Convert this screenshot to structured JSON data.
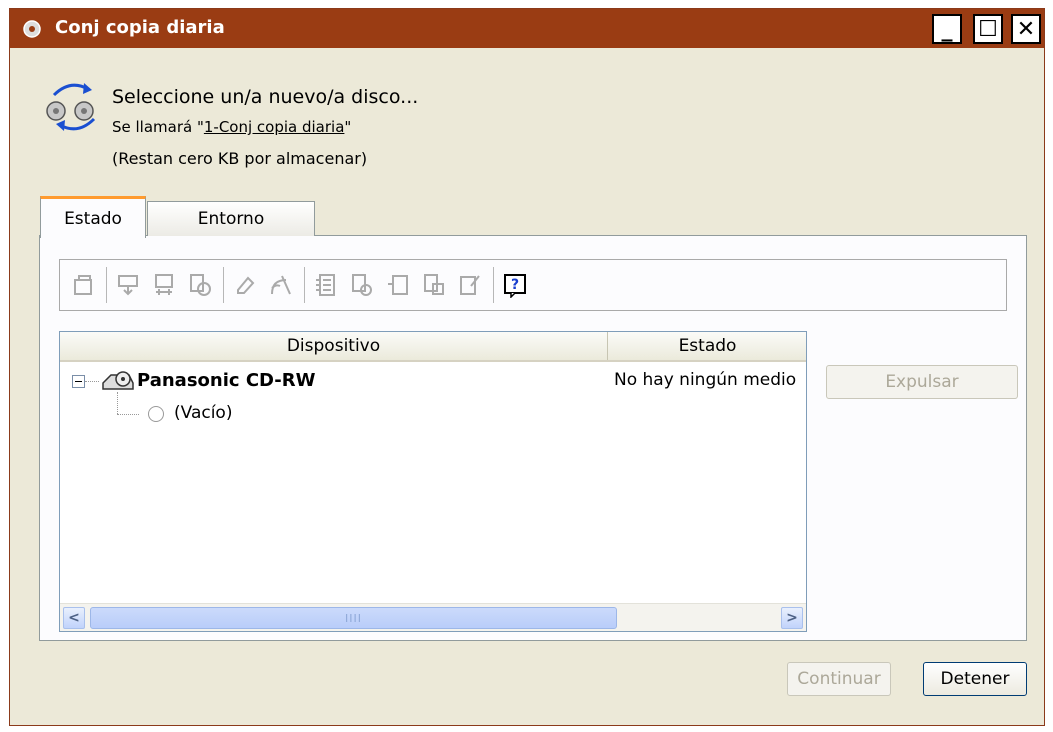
{
  "window": {
    "title": "Conj copia diaria",
    "title_bar_color": "#9a3c13",
    "controls": {
      "minimize_glyph": "_",
      "maximize_glyph": "☐",
      "close_glyph": "✕"
    }
  },
  "header": {
    "line1": "Seleccione un/a nuevo/a disco...",
    "line2_prefix": "Se llamará \"",
    "line2_name": "1-Conj copia diaria",
    "line2_suffix": "\"",
    "line3": "(Restan cero KB por almacenar)"
  },
  "tabs": [
    {
      "label": "Estado",
      "active": true
    },
    {
      "label": "Entorno",
      "active": false
    }
  ],
  "toolbar": {
    "icons": [
      "properties-icon",
      "import-icon",
      "export-icon",
      "copy-disc-icon",
      "erase-icon",
      "wireless-icon",
      "list-icon",
      "edit-disc-icon",
      "new-doc-icon",
      "disc-doc-icon",
      "settings-doc-icon",
      "help-icon"
    ],
    "help_glyph": "?"
  },
  "device_list": {
    "columns": {
      "device": "Dispositivo",
      "status": "Estado"
    },
    "rows": [
      {
        "device": "Panasonic CD-RW",
        "status": "No hay ningún medio",
        "children": [
          {
            "label": "(Vacío)"
          }
        ]
      }
    ],
    "scroll_grip": "IIII"
  },
  "buttons": {
    "eject": "Expulsar",
    "continue": "Continuar",
    "stop": "Detener"
  }
}
